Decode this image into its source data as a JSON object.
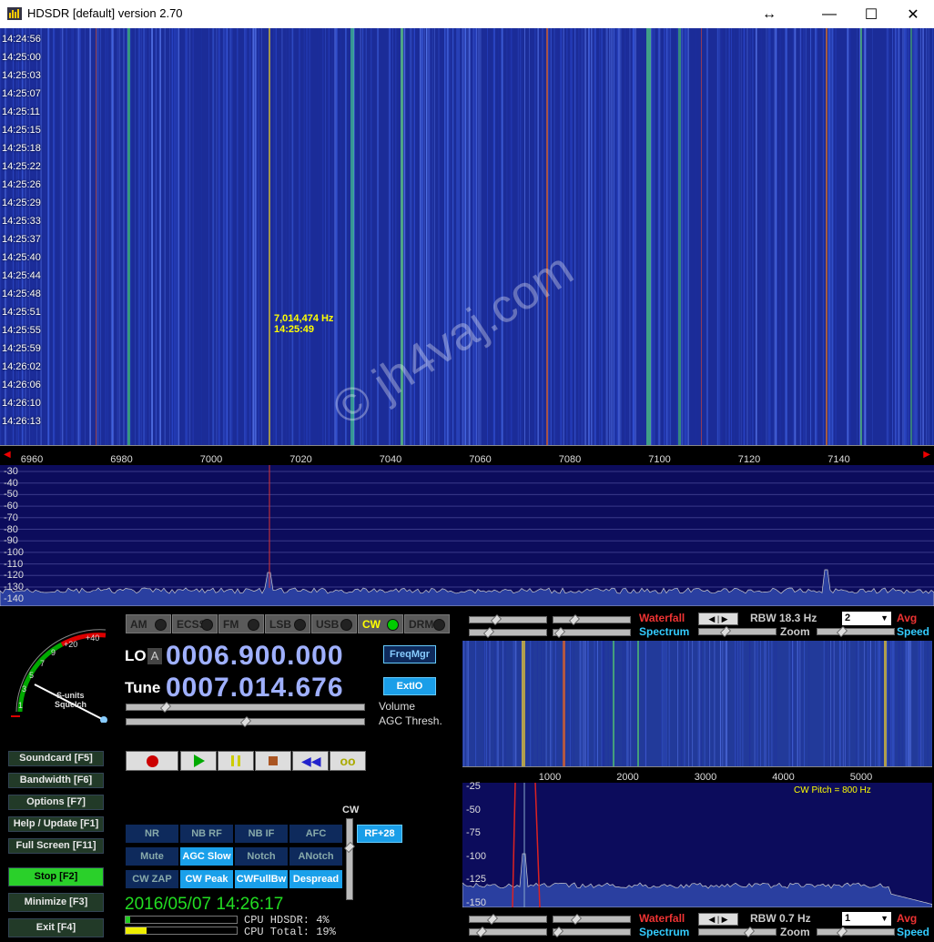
{
  "window": {
    "title": "HDSDR [default]  version 2.70",
    "resize_glyph": "↔",
    "minimize_glyph": "—",
    "maximize_glyph": "☐",
    "close_glyph": "✕"
  },
  "waterfall": {
    "time_labels": [
      "14:24:56",
      "14:25:00",
      "14:25:03",
      "14:25:07",
      "14:25:11",
      "14:25:15",
      "14:25:18",
      "14:25:22",
      "14:25:26",
      "14:25:29",
      "14:25:33",
      "14:25:37",
      "14:25:40",
      "14:25:44",
      "14:25:48",
      "14:25:51",
      "14:25:55",
      "14:25:59",
      "14:26:02",
      "14:26:06",
      "14:26:10",
      "14:26:13"
    ],
    "cursor_freq": "7,014,474 Hz",
    "cursor_time": "14:25:49"
  },
  "freq_axis": {
    "ticks": [
      "6960",
      "6980",
      "7000",
      "7020",
      "7040",
      "7060",
      "7080",
      "7100",
      "7120",
      "7140"
    ]
  },
  "spectrum": {
    "db_labels": [
      "-30",
      "-40",
      "-50",
      "-60",
      "-70",
      "-80",
      "-90",
      "-100",
      "-110",
      "-120",
      "-130",
      "-140"
    ]
  },
  "smeter": {
    "scale": [
      "1",
      "3",
      "5",
      "7",
      "9",
      "+20",
      "+40"
    ],
    "caption1": "S-units",
    "caption2": "Squelch"
  },
  "modes": [
    {
      "label": "AM",
      "on": false
    },
    {
      "label": "ECSS",
      "on": false
    },
    {
      "label": "FM",
      "on": false
    },
    {
      "label": "LSB",
      "on": false
    },
    {
      "label": "USB",
      "on": false
    },
    {
      "label": "CW",
      "on": true
    },
    {
      "label": "DRM",
      "on": false
    }
  ],
  "lo": {
    "label": "LO",
    "badge": "A",
    "value": "0006.900.000"
  },
  "tune": {
    "label": "Tune",
    "value": "0007.014.676"
  },
  "buttons": {
    "freqmgr": "FreqMgr",
    "extio": "ExtIO",
    "rf": "RF+28"
  },
  "sliders": {
    "volume": "Volume",
    "agc": "AGC Thresh."
  },
  "side_buttons": [
    {
      "label": "Soundcard  [F5]",
      "active": false
    },
    {
      "label": "Bandwidth  [F6]",
      "active": false
    },
    {
      "label": "Options   [F7]",
      "active": false
    },
    {
      "label": "Help / Update  [F1]",
      "active": false
    },
    {
      "label": "Full Screen  [F11]",
      "active": false
    },
    {
      "label": "Stop       [F2]",
      "active": true
    },
    {
      "label": "Minimize  [F3]",
      "active": false
    },
    {
      "label": "Exit       [F4]",
      "active": false
    }
  ],
  "dsp": {
    "cw_label": "CW",
    "row1": [
      {
        "label": "NR",
        "on": false
      },
      {
        "label": "NB RF",
        "on": false
      },
      {
        "label": "NB IF",
        "on": false
      },
      {
        "label": "AFC",
        "on": false
      }
    ],
    "row2": [
      {
        "label": "Mute",
        "on": false
      },
      {
        "label": "AGC Slow",
        "on": true
      },
      {
        "label": "Notch",
        "on": false
      },
      {
        "label": "ANotch",
        "on": false
      }
    ],
    "row3": [
      {
        "label": "CW ZAP",
        "on": false
      },
      {
        "label": "CW Peak",
        "on": true
      },
      {
        "label": "CWFullBw",
        "on": true
      },
      {
        "label": "Despread",
        "on": true
      }
    ]
  },
  "status": {
    "datetime": "2016/05/07 14:26:17",
    "cpu_hdsdr": "CPU HDSDR:  4%",
    "cpu_total": "CPU Total: 19%",
    "cpu_hdsdr_level": 0.04,
    "cpu_total_level": 0.19
  },
  "rf_panel": {
    "waterfall": "Waterfall",
    "spectrum": "Spectrum",
    "rbw": "RBW 18.3 Hz",
    "zoom": "Zoom",
    "avg_value": "2",
    "avg": "Avg",
    "speed": "Speed"
  },
  "af_panel": {
    "waterfall": "Waterfall",
    "spectrum": "Spectrum",
    "rbw": "RBW  0.7 Hz",
    "zoom": "Zoom",
    "avg_value": "1",
    "avg": "Avg",
    "speed": "Speed"
  },
  "af_axis": {
    "ticks": [
      "1000",
      "2000",
      "3000",
      "4000",
      "5000"
    ]
  },
  "af_spectrum": {
    "db_labels": [
      "-25",
      "-50",
      "-75",
      "-100",
      "-125",
      "-150"
    ],
    "pitch": "CW Pitch = 800 Hz"
  },
  "watermark": "© jh4vaj.com"
}
